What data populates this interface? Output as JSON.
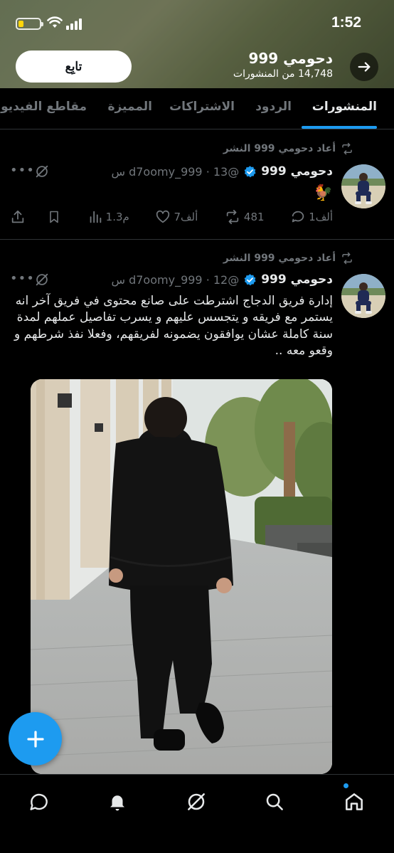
{
  "status_bar": {
    "time": "1:52"
  },
  "header": {
    "profile_name": "دحومي 999",
    "posts_count": "14,748 من المنشورات",
    "follow_label": "تابِع"
  },
  "tabs": [
    {
      "label": "المنشورات",
      "active": true
    },
    {
      "label": "الردود",
      "active": false
    },
    {
      "label": "الاشتراكات",
      "active": false
    },
    {
      "label": "المميزة",
      "active": false
    },
    {
      "label": "مقاطع الفيديو",
      "active": false
    }
  ],
  "posts": [
    {
      "retweet_label": "أعاد دحومي 999 النشر",
      "author": "دحومي 999",
      "handle_time": "@d7oomy_999 · 13 س",
      "text": "🐓",
      "actions": {
        "replies": "1ألف",
        "reposts": "481",
        "likes": "7ألف",
        "views": "1.3م"
      }
    },
    {
      "retweet_label": "أعاد دحومي 999 النشر",
      "author": "دحومي 999",
      "handle_time": "@d7oomy_999 · 12 س",
      "text": "إدارة فريق الدجاج اشترطت على صانع محتوى في فريق آخر انه يستمر مع فريقه و يتجسس عليهم و يسرب تفاصيل عملهم لمدة سنة كاملة عشان يوافقون يضمونه لفريقهم، وفعلا نفذ شرطهم و وقعو معه .."
    }
  ],
  "colors": {
    "accent": "#1d9bf0",
    "verified": "#1d9bf0",
    "muted": "#71767b",
    "border": "#2f3336"
  },
  "icons": [
    "back-arrow-icon",
    "verified-badge-icon",
    "repost-icon",
    "reply-icon",
    "like-icon",
    "views-icon",
    "bookmark-icon",
    "share-icon",
    "grok-icon",
    "compose-plus-icon",
    "home-icon",
    "search-icon",
    "notifications-icon",
    "messages-icon"
  ]
}
